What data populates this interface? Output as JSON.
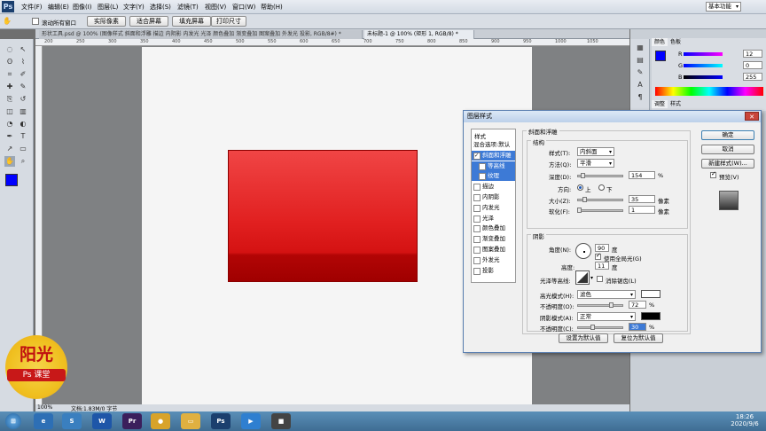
{
  "app": {
    "logo_text": "Ps"
  },
  "menu": [
    "文件(F)",
    "编辑(E)",
    "图像(I)",
    "图层(L)",
    "文字(Y)",
    "选择(S)",
    "滤镜(T)",
    "视图(V)",
    "窗口(W)",
    "帮助(H)"
  ],
  "workspace": {
    "label": "基本功能"
  },
  "options_bar": {
    "scroll_all_label": "滚动所有窗口",
    "buttons": [
      "实际像素",
      "适合屏幕",
      "填充屏幕",
      "打印尺寸"
    ]
  },
  "tabs": [
    {
      "label": "形状工具.psd @ 100% (图像样式 斜面和浮雕 描边 内阴影 内发光 光泽 颜色叠加 渐变叠加 图案叠加 外发光 投影, RGB/8#) *"
    },
    {
      "label": "未标题-1 @ 100% (矩形 1, RGB/8) *"
    }
  ],
  "ruler_top": [
    "200",
    "250",
    "300",
    "350",
    "400",
    "450",
    "500",
    "550",
    "600",
    "650",
    "700",
    "750",
    "800",
    "850",
    "900",
    "950",
    "1000",
    "1050"
  ],
  "status": {
    "zoom": "100%",
    "doc_info": "文档:1.83M/0 字节"
  },
  "color_panel": {
    "tabs": [
      "颜色",
      "色板"
    ],
    "r": "12",
    "g": "0",
    "b": "255"
  },
  "adjust_panel": {
    "tabs": [
      "调整",
      "样式"
    ]
  },
  "dialog": {
    "title": "图层样式",
    "styles_header": "样式",
    "styles": [
      {
        "label": "混合选项:默认",
        "checked": false,
        "active": false
      },
      {
        "label": "斜面和浮雕",
        "checked": true,
        "active": true
      },
      {
        "label": "等高线",
        "checked": false,
        "active": false
      },
      {
        "label": "纹理",
        "checked": false,
        "active": false
      },
      {
        "label": "描边",
        "checked": false,
        "active": false
      },
      {
        "label": "内阴影",
        "checked": false,
        "active": false
      },
      {
        "label": "内发光",
        "checked": false,
        "active": false
      },
      {
        "label": "光泽",
        "checked": false,
        "active": false
      },
      {
        "label": "颜色叠加",
        "checked": false,
        "active": false
      },
      {
        "label": "渐变叠加",
        "checked": false,
        "active": false
      },
      {
        "label": "图案叠加",
        "checked": false,
        "active": false
      },
      {
        "label": "外发光",
        "checked": false,
        "active": false
      },
      {
        "label": "投影",
        "checked": false,
        "active": false
      }
    ],
    "section_title": "斜面和浮雕",
    "structure_title": "结构",
    "style_label": "样式(T):",
    "style_value": "内斜面",
    "technique_label": "方法(Q):",
    "technique_value": "平滑",
    "depth_label": "深度(D):",
    "depth_value": "154",
    "depth_unit": "%",
    "direction_label": "方向:",
    "dir_up": "上",
    "dir_down": "下",
    "size_label": "大小(Z):",
    "size_value": "35",
    "size_unit": "像素",
    "soften_label": "软化(F):",
    "soften_value": "1",
    "soften_unit": "像素",
    "shading_title": "阴影",
    "angle_label": "角度(N):",
    "angle_value": "90",
    "angle_unit": "度",
    "global_light_label": "使用全局光(G)",
    "altitude_label": "高度:",
    "altitude_value": "11",
    "altitude_unit": "度",
    "gloss_label": "光泽等高线:",
    "antialias_label": "消除锯齿(L)",
    "highlight_mode_label": "高光模式(H):",
    "highlight_mode_value": "滤色",
    "highlight_opacity_label": "不透明度(O):",
    "highlight_opacity_value": "72",
    "highlight_opacity_unit": "%",
    "shadow_mode_label": "阴影模式(A):",
    "shadow_mode_value": "正常",
    "shadow_opacity_label": "不透明度(C):",
    "shadow_opacity_value": "30",
    "shadow_opacity_unit": "%",
    "default_set": "设置为默认值",
    "default_reset": "复位为默认值",
    "ok": "确定",
    "cancel": "取消",
    "new_style": "新建样式(W)...",
    "preview": "预览(V)"
  },
  "taskbar": {
    "time": "18:26",
    "date": "2020/9/6"
  },
  "watermark": {
    "title": "阳光",
    "band": "Ps 课堂"
  }
}
